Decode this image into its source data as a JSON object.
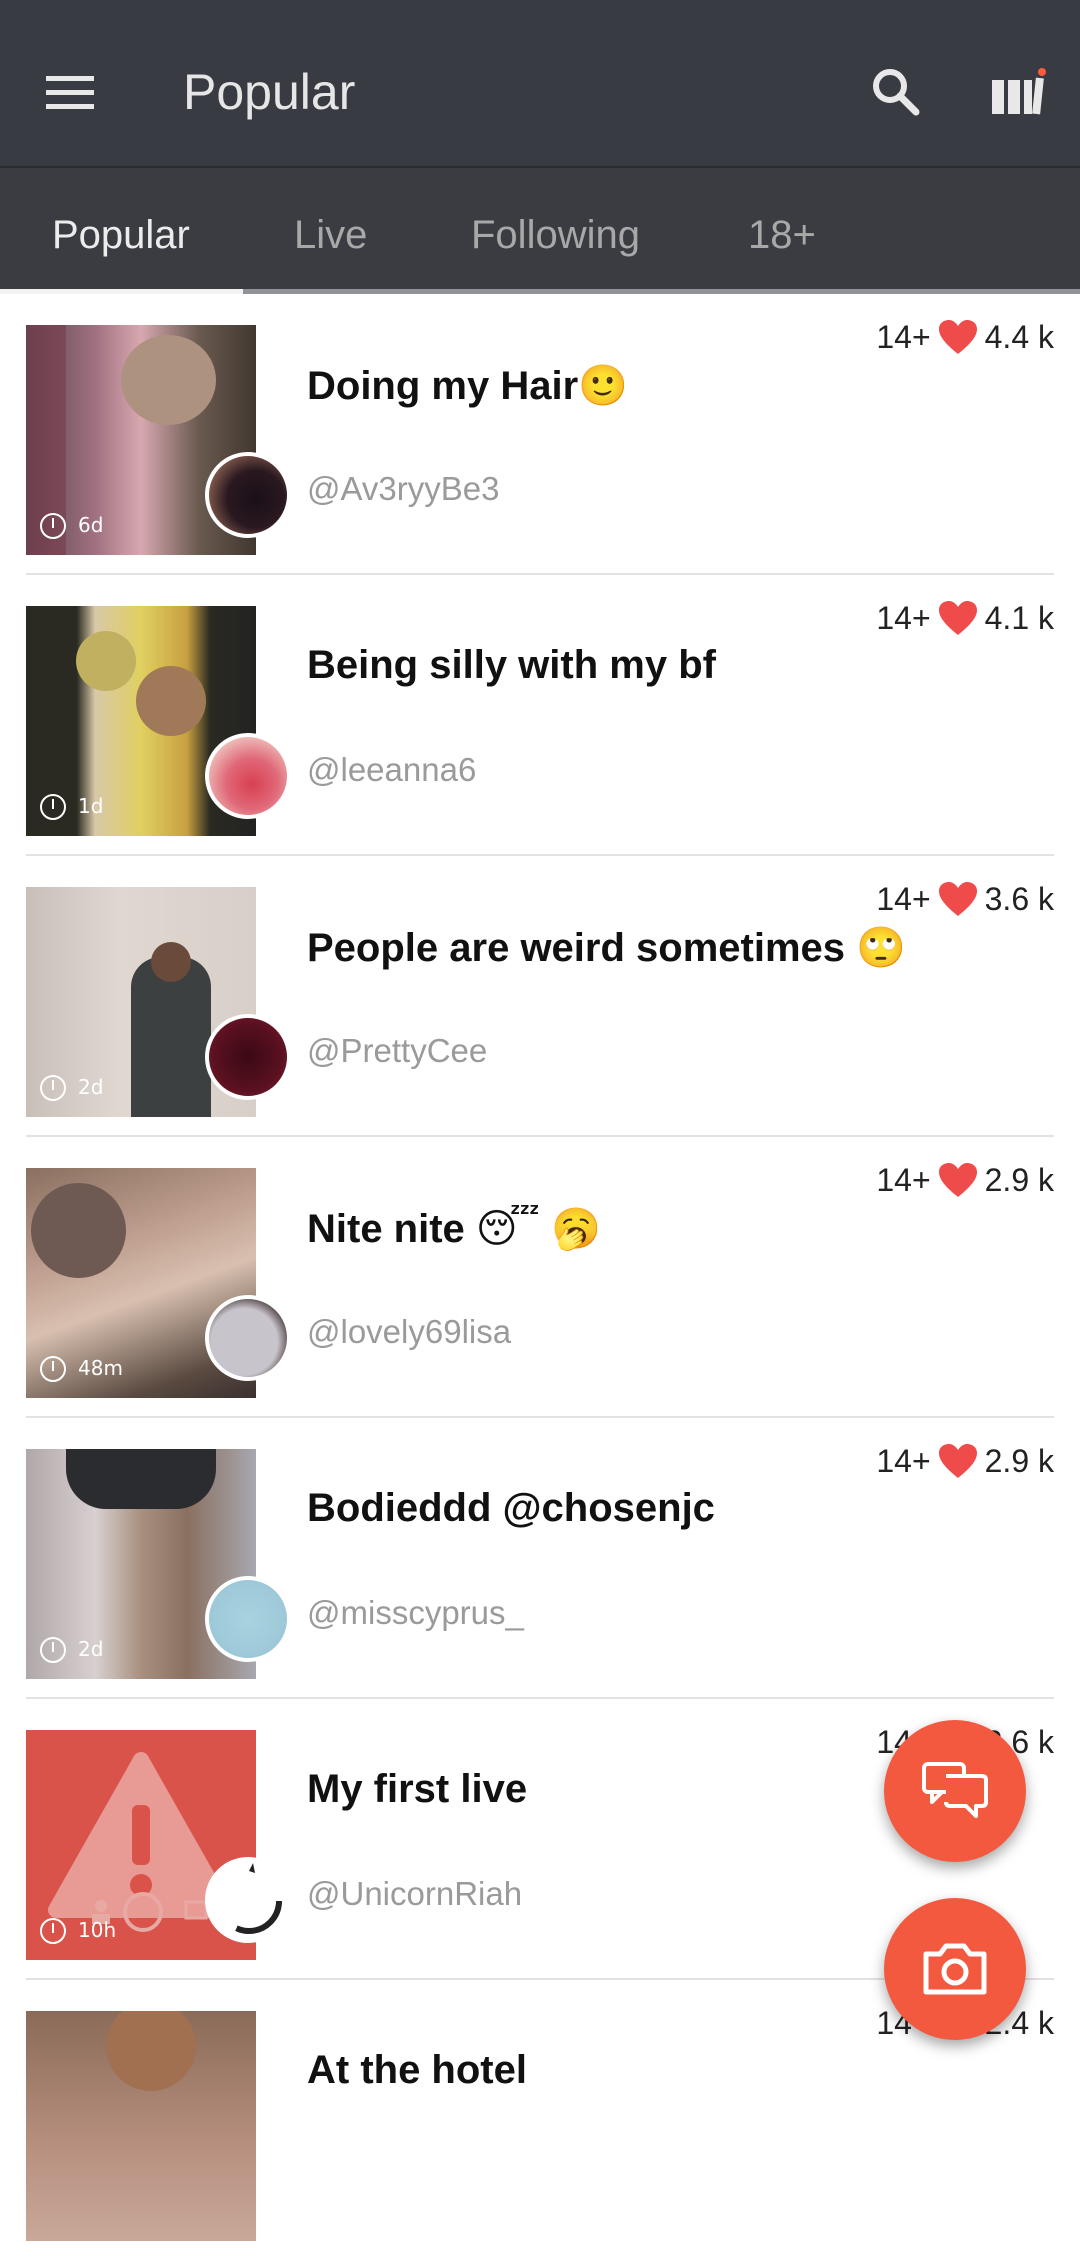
{
  "appbar": {
    "title": "Popular",
    "icons": [
      "menu-icon",
      "search-icon",
      "library-icon"
    ],
    "notification_dot_color": "#ff5a3c"
  },
  "tabs": [
    {
      "label": "Popular",
      "active": true
    },
    {
      "label": "Live",
      "active": false
    },
    {
      "label": "Following",
      "active": false
    },
    {
      "label": "18+",
      "active": false
    }
  ],
  "accent_color": "#f2593f",
  "posts": [
    {
      "title": "Doing my Hair🙂",
      "user": "@Av3ryyBe3",
      "age": "14+",
      "likes": "4.4 k",
      "time": "6d"
    },
    {
      "title": "Being silly with my bf",
      "user": "@leeanna6",
      "age": "14+",
      "likes": "4.1 k",
      "time": "1d"
    },
    {
      "title": "People are weird sometimes 🙄",
      "user": "@PrettyCee",
      "age": "14+",
      "likes": "3.6 k",
      "time": "2d"
    },
    {
      "title": "Nite nite 😴 🥱",
      "user": "@lovely69lisa",
      "age": "14+",
      "likes": "2.9 k",
      "time": "48m"
    },
    {
      "title": "Bodieddd @chosenjc",
      "user": "@misscyprus_",
      "age": "14+",
      "likes": "2.9 k",
      "time": "2d"
    },
    {
      "title": "My first live",
      "user": "@UnicornRiah",
      "age": "14+",
      "likes": "2.6 k",
      "time": "10h"
    },
    {
      "title": "At the hotel",
      "user": "",
      "age": "14+",
      "likes": "2.4 k",
      "time": ""
    }
  ],
  "fabs": [
    "chat-icon",
    "camera-icon"
  ]
}
